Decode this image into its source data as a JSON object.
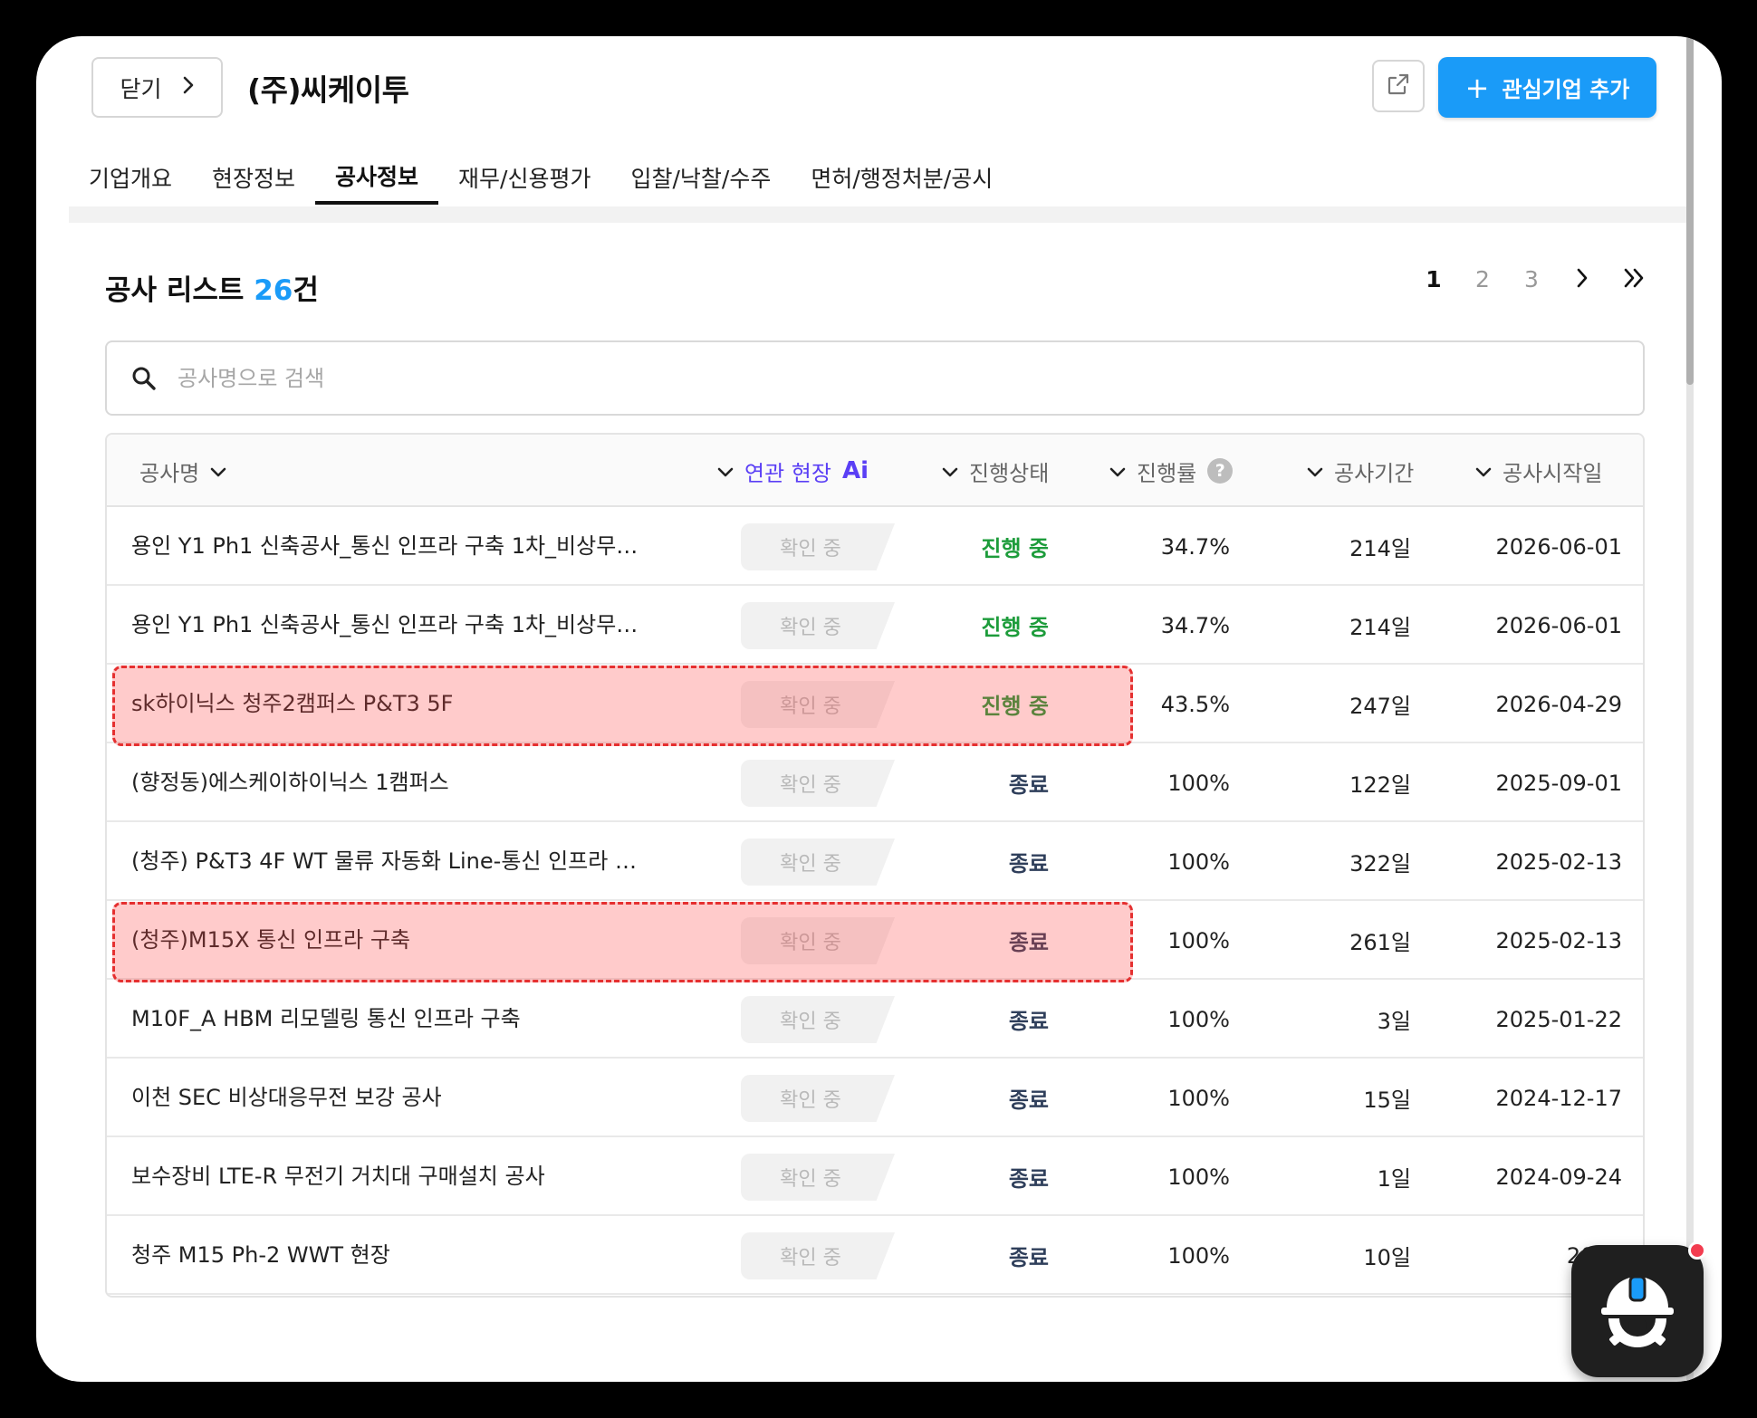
{
  "header": {
    "close_label": "닫기",
    "company_name": "(주)씨케이투",
    "add_button_label": "관심기업 추가",
    "add_button_plus": "+"
  },
  "tabs": [
    {
      "label": "기업개요",
      "active": false
    },
    {
      "label": "현장정보",
      "active": false
    },
    {
      "label": "공사정보",
      "active": true
    },
    {
      "label": "재무/신용평가",
      "active": false
    },
    {
      "label": "입찰/낙찰/수주",
      "active": false
    },
    {
      "label": "면허/행정처분/공시",
      "active": false
    }
  ],
  "list": {
    "title": "공사 리스트",
    "count": "26",
    "count_unit": "건"
  },
  "pagination": {
    "pages": [
      "1",
      "2",
      "3"
    ],
    "current": "1"
  },
  "search": {
    "placeholder": "공사명으로 검색",
    "value": ""
  },
  "columns": {
    "name": "공사명",
    "related": "연관 현장",
    "related_badge": "Ai",
    "status": "진행상태",
    "rate": "진행률",
    "rate_help": "?",
    "period": "공사기간",
    "start": "공사시작일"
  },
  "rows": [
    {
      "name": "용인 Y1 Ph1 신축공사_통신 인프라 구축 1차_비상무…",
      "related": "확인 중",
      "status": "진행 중",
      "status_kind": "ongoing",
      "rate": "34.7%",
      "period": "214일",
      "start": "2026-06-01"
    },
    {
      "name": "용인 Y1 Ph1 신축공사_통신 인프라 구축 1차_비상무…",
      "related": "확인 중",
      "status": "진행 중",
      "status_kind": "ongoing",
      "rate": "34.7%",
      "period": "214일",
      "start": "2026-06-01"
    },
    {
      "name": "sk하이닉스 청주2캠퍼스 P&T3 5F",
      "related": "확인 중",
      "status": "진행 중",
      "status_kind": "ongoing",
      "rate": "43.5%",
      "period": "247일",
      "start": "2026-04-29"
    },
    {
      "name": "(향정동)에스케이하이닉스 1캠퍼스",
      "related": "확인 중",
      "status": "종료",
      "status_kind": "ended",
      "rate": "100%",
      "period": "122일",
      "start": "2025-09-01"
    },
    {
      "name": "(청주) P&T3 4F WT 물류 자동화 Line-통신 인프라 구…",
      "related": "확인 중",
      "status": "종료",
      "status_kind": "ended",
      "rate": "100%",
      "period": "322일",
      "start": "2025-02-13"
    },
    {
      "name": "(청주)M15X 통신 인프라 구축",
      "related": "확인 중",
      "status": "종료",
      "status_kind": "ended",
      "rate": "100%",
      "period": "261일",
      "start": "2025-02-13"
    },
    {
      "name": "M10F_A HBM 리모델링 통신 인프라 구축",
      "related": "확인 중",
      "status": "종료",
      "status_kind": "ended",
      "rate": "100%",
      "period": "3일",
      "start": "2025-01-22"
    },
    {
      "name": "이천 SEC 비상대응무전 보강 공사",
      "related": "확인 중",
      "status": "종료",
      "status_kind": "ended",
      "rate": "100%",
      "period": "15일",
      "start": "2024-12-17"
    },
    {
      "name": "보수장비 LTE-R 무전기 거치대 구매설치 공사",
      "related": "확인 중",
      "status": "종료",
      "status_kind": "ended",
      "rate": "100%",
      "period": "1일",
      "start": "2024-09-24"
    },
    {
      "name": "청주 M15 Ph-2 WWT 현장",
      "related": "확인 중",
      "status": "종료",
      "status_kind": "ended",
      "rate": "100%",
      "period": "10일",
      "start": "2024"
    }
  ],
  "highlighted_rows": [
    2,
    5
  ],
  "icons": {
    "close": "chevron-right-icon",
    "share": "external-link-icon",
    "search": "search-icon",
    "sort": "chevron-down-icon",
    "bot": "helmet-bot-icon"
  },
  "colors": {
    "accent": "#1a9bf8",
    "ai": "#5a3ff5",
    "ongoing": "#1d9c3b",
    "ended": "#2f3f5b",
    "highlight_border": "#e53030",
    "notification": "#f23c4f"
  }
}
